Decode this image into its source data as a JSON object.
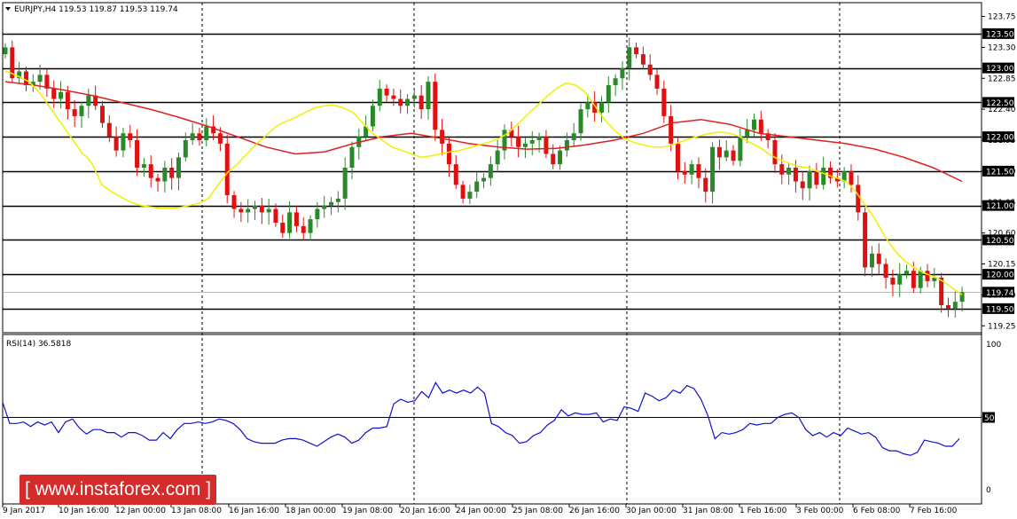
{
  "header": {
    "symbol_line": "EURJPY,H4  119.53 119.87 119.53 119.74",
    "rsi_label": "RSI(14) 36.5818"
  },
  "watermark": "[ www.instaforex.com ]",
  "colors": {
    "bull": "#2a8a2a",
    "bear": "#e01010",
    "ma_fast": "#f0f000",
    "ma_slow": "#e02020",
    "rsi": "#1010d0",
    "level_box": "#000000",
    "watermark": "#d42b2b"
  },
  "chart_data": [
    {
      "type": "candlestick",
      "instrument": "EURJPY",
      "timeframe": "H4",
      "ylim": [
        119.15,
        123.95
      ],
      "y_ticks": [
        "123.75",
        "123.30",
        "122.85",
        "122.40",
        "121.95",
        "121.50",
        "121.05",
        "120.60",
        "120.15",
        "119.70",
        "119.25"
      ],
      "levels": [
        {
          "value": 123.5,
          "label": "123.50"
        },
        {
          "value": 123.0,
          "label": "123.00"
        },
        {
          "value": 122.5,
          "label": "122.50"
        },
        {
          "value": 122.0,
          "label": "122.00"
        },
        {
          "value": 121.5,
          "label": "121.50"
        },
        {
          "value": 121.0,
          "label": "121.00"
        },
        {
          "value": 120.5,
          "label": "120.50"
        },
        {
          "value": 120.0,
          "label": "120.00"
        },
        {
          "value": 119.5,
          "label": "119.50"
        }
      ],
      "current_price": {
        "value": 119.74,
        "label": "119.74"
      },
      "x_labels": [
        "9 Jan 2017",
        "10 Jan 16:00",
        "12 Jan 00:00",
        "13 Jan 08:00",
        "16 Jan 16:00",
        "18 Jan 00:00",
        "19 Jan 08:00",
        "20 Jan 16:00",
        "24 Jan 00:00",
        "25 Jan 08:00",
        "26 Jan 16:00",
        "30 Jan 00:00",
        "31 Jan 08:00",
        "1 Feb 16:00",
        "3 Feb 00:00",
        "6 Feb 08:00",
        "7 Feb 16:00"
      ],
      "close": [
        123.3,
        122.85,
        122.95,
        122.75,
        122.8,
        122.9,
        122.7,
        122.55,
        122.65,
        122.4,
        122.3,
        122.45,
        122.6,
        122.45,
        122.2,
        122.0,
        121.8,
        122.05,
        121.95,
        121.55,
        121.6,
        121.4,
        121.35,
        121.55,
        121.4,
        121.7,
        121.95,
        122.05,
        121.95,
        122.15,
        122.05,
        121.9,
        121.15,
        120.95,
        120.9,
        120.95,
        121.0,
        120.9,
        120.95,
        120.75,
        120.6,
        120.9,
        120.7,
        120.6,
        120.8,
        120.95,
        121.0,
        121.05,
        121.1,
        121.55,
        121.85,
        122.0,
        122.15,
        122.45,
        122.7,
        122.6,
        122.55,
        122.45,
        122.55,
        122.6,
        122.4,
        122.8,
        122.1,
        121.9,
        121.6,
        121.3,
        121.1,
        121.2,
        121.35,
        121.4,
        121.6,
        121.8,
        122.1,
        122.0,
        121.85,
        121.9,
        121.95,
        122.0,
        121.75,
        121.6,
        121.8,
        121.95,
        122.05,
        122.4,
        122.5,
        122.35,
        122.5,
        122.75,
        122.85,
        123.0,
        123.3,
        123.2,
        123.05,
        122.9,
        122.7,
        122.3,
        121.9,
        121.5,
        121.45,
        121.6,
        121.4,
        121.2,
        121.85,
        121.7,
        121.8,
        121.65,
        122.0,
        122.1,
        122.25,
        122.05,
        121.95,
        121.6,
        121.45,
        121.55,
        121.35,
        121.25,
        121.5,
        121.3,
        121.55,
        121.4,
        121.35,
        121.5,
        121.3,
        120.9,
        120.1,
        120.3,
        120.15,
        119.95,
        119.85,
        120.0,
        120.05,
        119.8,
        120.05,
        119.9,
        119.95,
        119.55,
        119.5,
        119.6,
        119.74
      ],
      "ma_fast": [
        122.95,
        122.93,
        122.9,
        122.87,
        122.83,
        122.8,
        122.72,
        122.65,
        122.55,
        122.45,
        122.35,
        122.25,
        122.15,
        122.05,
        121.95,
        121.85,
        121.75,
        121.7,
        121.6,
        121.45,
        121.3,
        121.2,
        121.12,
        121.05,
        121.0,
        120.98,
        120.96,
        120.96,
        120.97,
        121.0,
        121.03,
        121.1,
        121.3,
        121.48,
        121.6,
        121.75,
        121.9,
        122.02,
        122.15,
        122.22,
        122.28,
        122.35,
        122.42,
        122.45,
        122.46,
        122.42,
        122.35,
        122.2,
        122.05,
        121.95,
        121.85,
        121.8,
        121.75,
        121.7,
        121.72,
        121.75,
        121.78,
        121.8,
        121.84,
        121.88,
        121.92,
        121.97,
        122.05,
        122.18,
        122.32,
        122.45,
        122.58,
        122.7,
        122.78,
        122.75,
        122.65,
        122.45,
        122.25,
        122.1,
        121.98,
        121.92,
        121.88,
        121.85,
        121.85,
        121.88,
        121.93,
        121.98,
        122.02,
        122.05,
        122.07,
        122.05,
        122.0,
        121.92,
        121.85,
        121.75,
        121.67,
        121.62,
        121.57,
        121.55,
        121.5,
        121.45,
        121.4,
        121.35,
        121.2,
        121.0,
        120.8,
        120.55,
        120.35,
        120.2,
        120.1,
        120.02,
        119.97,
        119.9,
        119.8,
        119.7
      ],
      "ma_fast_x": [
        0,
        1,
        2,
        3,
        4,
        5,
        6,
        7,
        8,
        9,
        10,
        11,
        12,
        13,
        14,
        15,
        16,
        17,
        18,
        19,
        20,
        22,
        24,
        26,
        28,
        30,
        32,
        34,
        36,
        38,
        40,
        42,
        44,
        46,
        48,
        50,
        52,
        54,
        56,
        58,
        60,
        62,
        64,
        66,
        68,
        70,
        72,
        74,
        76,
        78,
        80,
        82,
        84,
        86,
        88,
        90,
        92,
        94,
        96,
        98,
        100,
        102,
        104,
        106,
        108,
        110,
        112,
        114,
        116,
        118,
        120,
        122,
        124,
        126,
        128,
        130,
        132,
        134,
        136,
        138,
        140,
        142,
        144,
        146,
        148,
        150,
        152,
        154,
        156,
        158,
        160,
        162,
        164,
        166,
        168,
        170,
        172,
        174,
        176,
        178,
        180,
        182,
        184,
        186,
        188,
        190,
        192,
        194,
        196,
        198
      ],
      "ma_slow_x": [
        0,
        6,
        12,
        18,
        24,
        30,
        36,
        42,
        48,
        54,
        60,
        66,
        72,
        78,
        84,
        90,
        96,
        102,
        108,
        114,
        120,
        126,
        132,
        138,
        144,
        150,
        156,
        162,
        168,
        174,
        180,
        186,
        192,
        198
      ],
      "ma_slow": [
        122.8,
        122.75,
        122.68,
        122.6,
        122.5,
        122.4,
        122.28,
        122.15,
        122.0,
        121.85,
        121.75,
        121.78,
        121.9,
        122.0,
        122.05,
        121.98,
        121.9,
        121.85,
        121.82,
        121.83,
        121.88,
        121.95,
        122.05,
        122.2,
        122.25,
        122.18,
        122.05,
        122.0,
        121.95,
        121.9,
        121.82,
        121.7,
        121.55,
        121.35
      ],
      "rsi": {
        "ylim": [
          0,
          100
        ],
        "y_ticks": [
          "100",
          "50",
          "0"
        ],
        "level": 50,
        "values": [
          60,
          46,
          46,
          47,
          44,
          47,
          45,
          47,
          40,
          47,
          49,
          43,
          39,
          42,
          42,
          40,
          40,
          37,
          40,
          40,
          38,
          35,
          35,
          40,
          36,
          42,
          46,
          46,
          47,
          46,
          47,
          49,
          48,
          46,
          42,
          36,
          34,
          33,
          33,
          33,
          35,
          36,
          36,
          35,
          33,
          31,
          34,
          37,
          39,
          37,
          33,
          35,
          40,
          43,
          43,
          44,
          59,
          62,
          60,
          61,
          67,
          63,
          73,
          66,
          68,
          66,
          68,
          66,
          70,
          66,
          46,
          44,
          40,
          38,
          33,
          34,
          38,
          40,
          45,
          48,
          55,
          51,
          53,
          52,
          52,
          53,
          47,
          49,
          48,
          57,
          56,
          54,
          66,
          64,
          61,
          63,
          68,
          66,
          71,
          69,
          62,
          51,
          36,
          40,
          39,
          40,
          42,
          46,
          45,
          46,
          46,
          50,
          52,
          53,
          50,
          42,
          38,
          40,
          37,
          40,
          38,
          43,
          41,
          39,
          40,
          37,
          30,
          28,
          28,
          26,
          25,
          27,
          35,
          34,
          33,
          31,
          31,
          36
        ]
      }
    }
  ]
}
